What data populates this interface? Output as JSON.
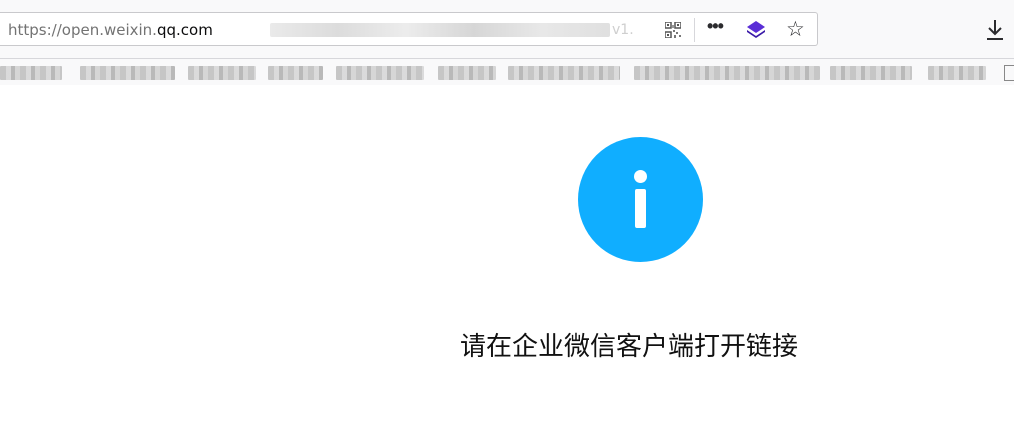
{
  "browser": {
    "url_prefix": "https://open.weixin.",
    "url_host": "qq.com",
    "url_tail_fragment": "v1.",
    "icons": [
      "qr-code-icon",
      "more-icon",
      "layers-icon",
      "bookmark-star-icon",
      "download-icon"
    ],
    "more_label": "•••",
    "star_label": "☆"
  },
  "page": {
    "icon": "info-icon",
    "message": "请在企业微信客户端打开链接",
    "accent_color": "#10aeff"
  }
}
